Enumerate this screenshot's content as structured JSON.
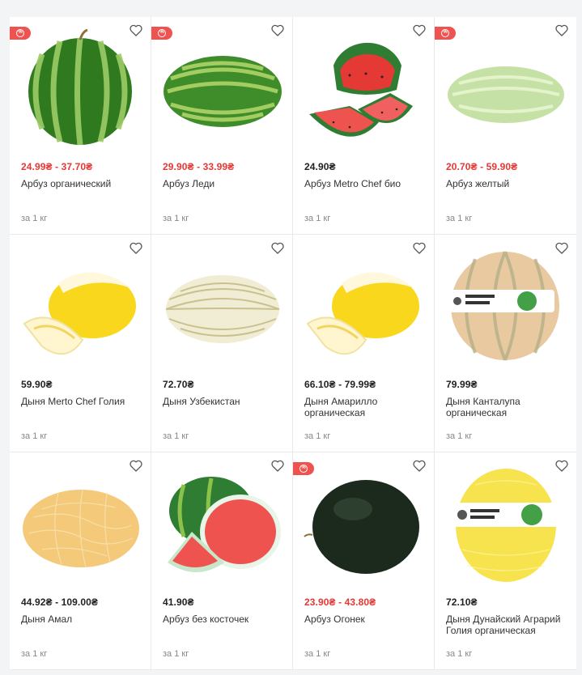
{
  "colors": {
    "sale_price": "#e53935",
    "regular_price": "#222222",
    "badge": "#ef5350"
  },
  "products": [
    {
      "price": "24.99₴ - 37.70₴",
      "sale": true,
      "name": "Арбуз органический",
      "unit": "за 1 кг",
      "badge": true,
      "image": "watermelon-whole-round"
    },
    {
      "price": "29.90₴ - 33.99₴",
      "sale": true,
      "name": "Арбуз Леди",
      "unit": "за 1 кг",
      "badge": true,
      "image": "watermelon-oblong"
    },
    {
      "price": "24.90₴",
      "sale": false,
      "name": "Арбуз Metro Chef био",
      "unit": "за 1 кг",
      "badge": false,
      "image": "watermelon-sliced"
    },
    {
      "price": "20.70₴ - 59.90₴",
      "sale": true,
      "name": "Арбуз желтый",
      "unit": "за 1 кг",
      "badge": true,
      "image": "watermelon-pale"
    },
    {
      "price": "59.90₴",
      "sale": false,
      "name": "Дыня Merto Chef Голия",
      "unit": "за 1 кг",
      "badge": false,
      "image": "melon-yellow-sliced"
    },
    {
      "price": "72.70₴",
      "sale": false,
      "name": "Дыня Узбекистан",
      "unit": "за 1 кг",
      "badge": false,
      "image": "melon-striped"
    },
    {
      "price": "66.10₴ - 79.99₴",
      "sale": false,
      "name": "Дыня Амарилло органическая",
      "unit": "за 1 кг",
      "badge": false,
      "image": "melon-yellow-sliced"
    },
    {
      "price": "79.99₴",
      "sale": false,
      "name": "Дыня Канталупа органическая",
      "unit": "за 1 кг",
      "badge": false,
      "image": "melon-cantaloupe"
    },
    {
      "price": "44.92₴ - 109.00₴",
      "sale": false,
      "name": "Дыня Амал",
      "unit": "за 1 кг",
      "badge": false,
      "image": "melon-netted"
    },
    {
      "price": "41.90₴",
      "sale": false,
      "name": "Арбуз без косточек",
      "unit": "за 1 кг",
      "badge": false,
      "image": "watermelon-half"
    },
    {
      "price": "23.90₴ - 43.80₴",
      "sale": true,
      "name": "Арбуз Огонек",
      "unit": "за 1 кг",
      "badge": true,
      "image": "watermelon-dark"
    },
    {
      "price": "72.10₴",
      "sale": false,
      "name": "Дыня Дунайский Аграрий Голия органическая",
      "unit": "за 1 кг",
      "badge": false,
      "image": "melon-galia-label"
    }
  ]
}
